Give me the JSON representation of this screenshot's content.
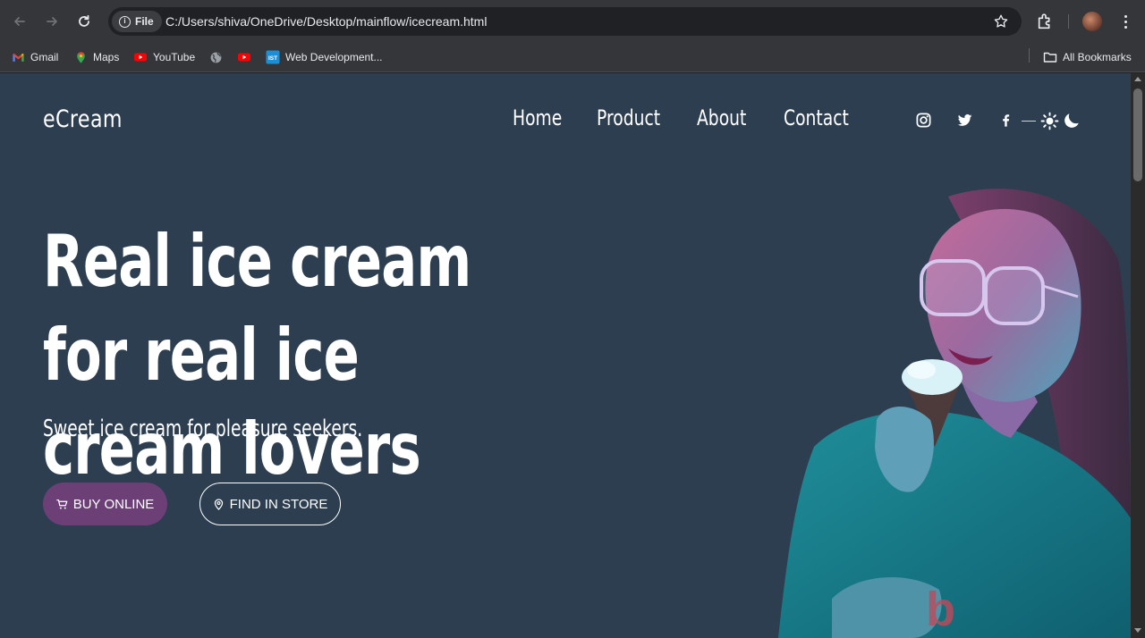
{
  "browser": {
    "file_chip_label": "File",
    "url": "C:/Users/shiva/OneDrive/Desktop/mainflow/icecream.html",
    "bookmarks": [
      {
        "label": "Gmail",
        "icon": "gmail-icon"
      },
      {
        "label": "Maps",
        "icon": "maps-icon"
      },
      {
        "label": "YouTube",
        "icon": "youtube-icon"
      },
      {
        "label": "",
        "icon": "globe-icon"
      },
      {
        "label": "",
        "icon": "youtube-icon"
      },
      {
        "label": "Web Development...",
        "icon": "ist-icon",
        "badge": "IST"
      }
    ],
    "all_bookmarks_label": "All Bookmarks"
  },
  "page": {
    "brand": "eCream",
    "nav": [
      "Home",
      "Product",
      "About",
      "Contact"
    ],
    "social_icons": [
      "instagram-icon",
      "twitter-icon",
      "facebook-icon"
    ],
    "theme_toggle_icons": [
      "sun-icon",
      "moon-icon"
    ],
    "hero": {
      "title": "Real ice cream for real ice cream lovers",
      "subtitle": "Sweet ice cream for pleasure seekers.",
      "buy_button": "BUY ONLINE",
      "store_button": "FIND IN STORE"
    }
  },
  "colors": {
    "page_bg": "#2c3e50",
    "buy_button_bg": "#6c4077",
    "chrome_bg": "#35363a",
    "omnibox_bg": "#202124"
  }
}
